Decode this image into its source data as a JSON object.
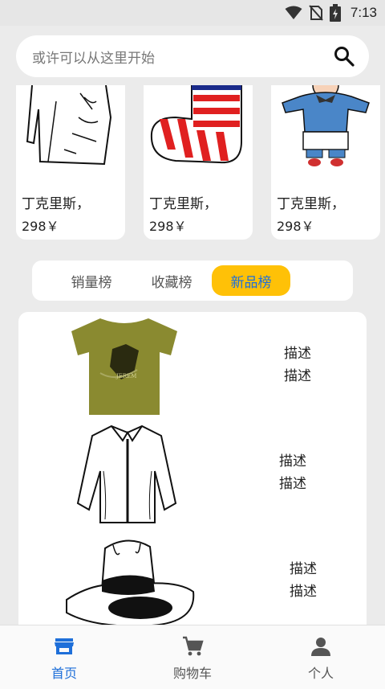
{
  "status_bar": {
    "time": "7:13"
  },
  "search": {
    "placeholder": "或许可以从这里开始"
  },
  "cards": [
    {
      "name": "丁克里斯，",
      "price": "298￥"
    },
    {
      "name": "丁克里斯，",
      "price": "298￥"
    },
    {
      "name": "丁克里斯，",
      "price": "298￥"
    }
  ],
  "tabs": [
    {
      "label": "销量榜"
    },
    {
      "label": "收藏榜"
    },
    {
      "label": "新品榜"
    }
  ],
  "active_tab": "新品榜",
  "list": [
    {
      "desc1": "描述",
      "desc2": "描述"
    },
    {
      "desc1": "描述",
      "desc2": "描述"
    },
    {
      "desc1": "描述",
      "desc2": "描述"
    }
  ],
  "nav": [
    {
      "label": "首页"
    },
    {
      "label": "购物车"
    },
    {
      "label": "个人"
    }
  ],
  "colors": {
    "accent": "#1e6fd9",
    "tab_active_bg": "#ffc107",
    "background": "#ebebeb"
  }
}
